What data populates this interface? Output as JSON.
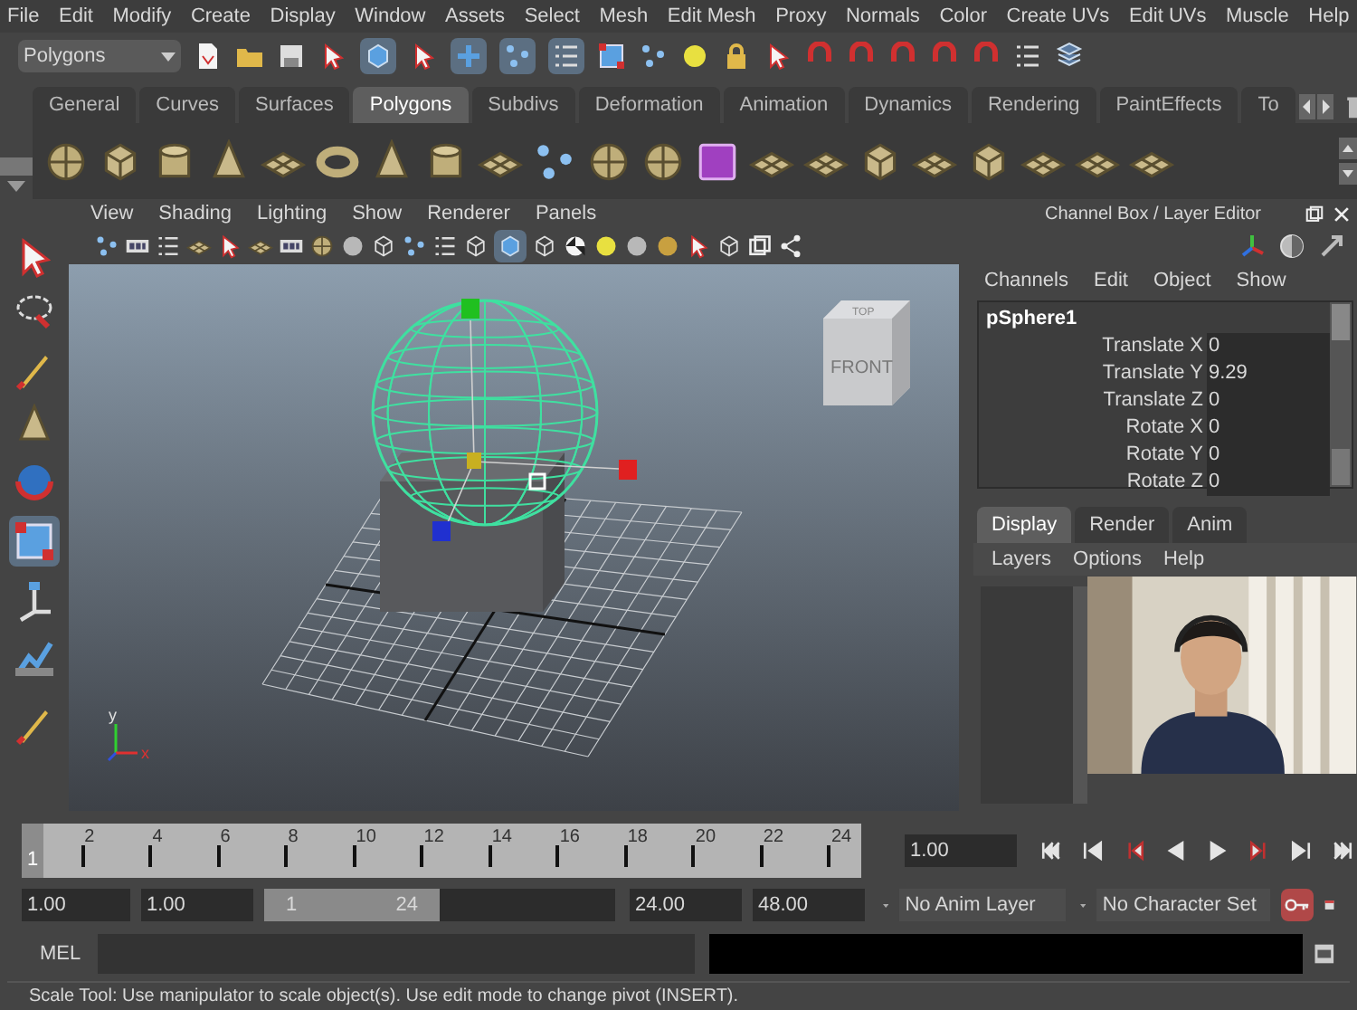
{
  "menu_bar": [
    "File",
    "Edit",
    "Modify",
    "Create",
    "Display",
    "Window",
    "Assets",
    "Select",
    "Mesh",
    "Edit Mesh",
    "Proxy",
    "Normals",
    "Color",
    "Create UVs",
    "Edit UVs",
    "Muscle",
    "Help"
  ],
  "mode_menu": {
    "value": "Polygons"
  },
  "shelf_tabs": [
    {
      "label": "General",
      "selected": false
    },
    {
      "label": "Curves",
      "selected": false
    },
    {
      "label": "Surfaces",
      "selected": false
    },
    {
      "label": "Polygons",
      "selected": true
    },
    {
      "label": "Subdivs",
      "selected": false
    },
    {
      "label": "Deformation",
      "selected": false
    },
    {
      "label": "Animation",
      "selected": false
    },
    {
      "label": "Dynamics",
      "selected": false
    },
    {
      "label": "Rendering",
      "selected": false
    },
    {
      "label": "PaintEffects",
      "selected": false
    },
    {
      "label": "To",
      "selected": false
    }
  ],
  "viewport": {
    "menu": [
      "View",
      "Shading",
      "Lighting",
      "Show",
      "Renderer",
      "Panels"
    ],
    "view_cube": {
      "top": "TOP",
      "front": "FRONT"
    },
    "axis": {
      "y": "y",
      "x": "x"
    }
  },
  "channel_box": {
    "title": "Channel Box / Layer Editor",
    "menu": [
      "Channels",
      "Edit",
      "Object",
      "Show"
    ],
    "object": "pSphere1",
    "attributes": [
      {
        "name": "Translate X",
        "value": "0"
      },
      {
        "name": "Translate Y",
        "value": "9.29"
      },
      {
        "name": "Translate Z",
        "value": "0"
      },
      {
        "name": "Rotate X",
        "value": "0"
      },
      {
        "name": "Rotate Y",
        "value": "0"
      },
      {
        "name": "Rotate Z",
        "value": "0"
      }
    ]
  },
  "layer_editor": {
    "tabs": [
      {
        "label": "Display",
        "selected": true
      },
      {
        "label": "Render",
        "selected": false
      },
      {
        "label": "Anim",
        "selected": false
      }
    ],
    "menu": [
      "Layers",
      "Options",
      "Help"
    ]
  },
  "timeline": {
    "current_frame": "1",
    "level": 0,
    "labels": [
      "2",
      "4",
      "6",
      "8",
      "10",
      "12",
      "14",
      "16",
      "18",
      "20",
      "22",
      "24"
    ],
    "current_time": "1.00"
  },
  "range": {
    "start": "1.00",
    "playback_start": "1.00",
    "slider_start": "1",
    "slider_end": "24",
    "level": 0.5,
    "playback_end": "24.00",
    "end": "48.00",
    "anim_layer": "No Anim Layer",
    "character_set": "No Character Set"
  },
  "command_line": {
    "label": "MEL"
  },
  "help_line": "Scale Tool: Use manipulator to scale object(s). Use edit mode to change pivot (INSERT)."
}
